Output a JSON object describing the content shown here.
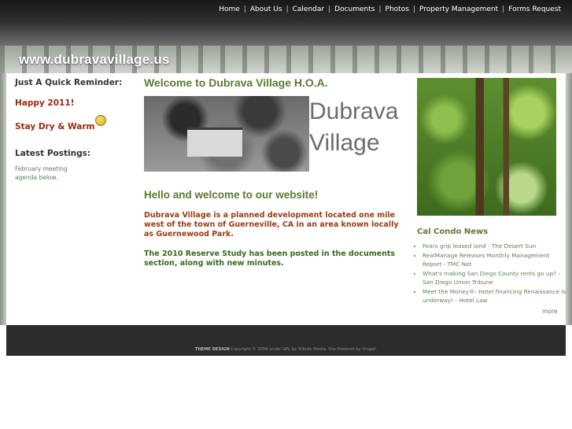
{
  "nav": {
    "items": [
      "Home",
      "About Us",
      "Calendar",
      "Documents",
      "Photos",
      "Property Management",
      "Forms Request"
    ],
    "separator": "|"
  },
  "banner": {
    "site_title": "www.dubravavillage.us"
  },
  "sidebar": {
    "reminder_heading": "Just A Quick Reminder:",
    "line1": "Happy 2011!",
    "line2": "Stay Dry & Warm",
    "postings_heading": "Latest Postings:",
    "posting_text": "February meeting agenda below."
  },
  "main": {
    "title": "Welcome to Dubrava Village H.O.A.",
    "brand_line1": "Dubrava",
    "brand_line2": "Village",
    "subtitle": "Hello and welcome to our website!",
    "paragraph1": "Dubrava Village is a planned development located one mile west of the town of Guerneville, CA in an area known locally as Guernewood Park.",
    "paragraph2": "The 2010 Reserve Study has been posted in the documents section, along with new minutes."
  },
  "news": {
    "title": "Cal Condo News",
    "items": [
      "Fears grip leased land - The Desert Sun",
      "RealManage Releases Monthly Management Report - TMC Net",
      "What's making San Diego County rents go up? - San Diego Union Tribune",
      "Meet the Money®: Hotel financing Renaissance is underway! - Hotel Law"
    ],
    "more": "more"
  },
  "footer": {
    "theme_design": "THEME DESIGN",
    "copyright": "Copyright © 2009 under",
    "gpl": "GPL",
    "by": "by",
    "tribute": "Tribute Media.",
    "site_powered": "Site Powered by",
    "drupal": "Drupal."
  },
  "colors": {
    "accent_green": "#5a7a33",
    "accent_red": "#9a3b12",
    "footer_bg": "#2c2c2c"
  },
  "icons": {
    "smiley": "smiley-icon"
  }
}
